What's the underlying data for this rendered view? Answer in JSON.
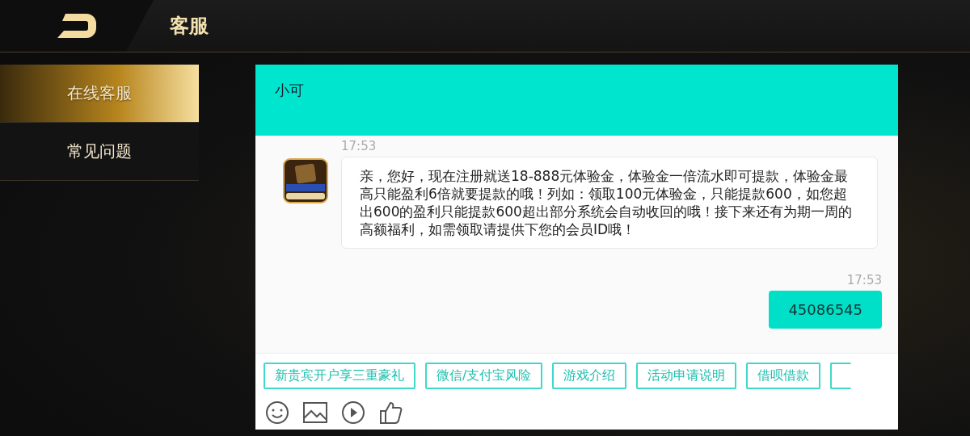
{
  "header": {
    "title": "客服"
  },
  "sidebar": {
    "items": [
      {
        "label": "在线客服",
        "selected": true
      },
      {
        "label": "常见问题",
        "selected": false
      }
    ]
  },
  "chat": {
    "agent_name": "小可",
    "messages": [
      {
        "kind": "agent",
        "time": "17:53",
        "text": "亲，您好，现在注册就送18-888元体验金，体验金一倍流水即可提款，体验金最高只能盈利6倍就要提款的哦！列如：领取100元体验金，只能提款600，如您超出600的盈利只能提款600超出部分系统会自动收回的哦！接下来还有为期一周的高额福利，如需领取请提供下您的会员ID哦！"
      },
      {
        "kind": "user",
        "time": "17:53",
        "text": "45086545"
      }
    ],
    "quick_replies": [
      "新贵宾开户享三重豪礼",
      "微信/支付宝风险",
      "游戏介绍",
      "活动申请说明",
      "借呗借款"
    ]
  }
}
